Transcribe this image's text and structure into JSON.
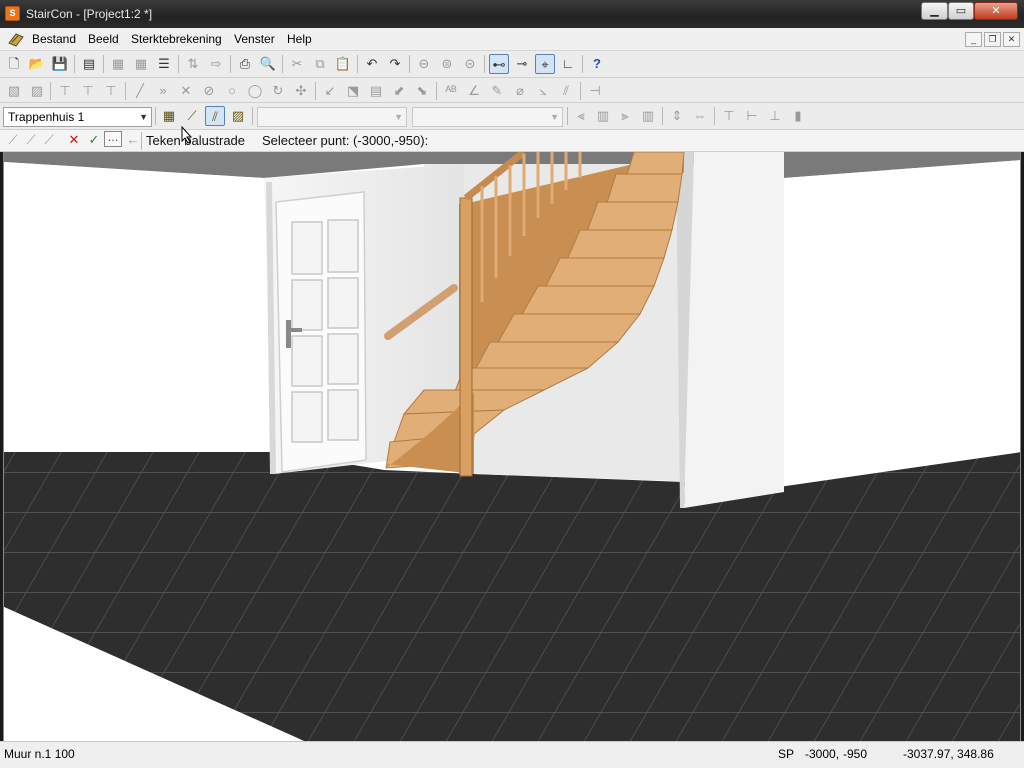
{
  "window": {
    "title": "StairCon - [Project1:2 *]",
    "app_icon_glyph": "S"
  },
  "menu": {
    "items": [
      "Bestand",
      "Beeld",
      "Sterktebrekening",
      "Venster",
      "Help"
    ]
  },
  "toolbar3": {
    "stairwell_select": "Trappenhuis 1",
    "combo2_value": "",
    "combo3_value": ""
  },
  "command_line": {
    "command": "Teken balustrade",
    "prompt": "Selecteer punt: (-3000,-950):"
  },
  "status": {
    "left": "Muur n.1 100",
    "sp_label": "SP",
    "x": "-3000,",
    "y": "-950",
    "coords": "-3037.97, 348.86"
  },
  "colors": {
    "floor": "#2b2b2b",
    "wood": "#d9a46b",
    "walls": "#f2f2f2",
    "accent_pressed": "#d4e4f7"
  },
  "icons": {
    "confirm": "check-icon",
    "cancel": "x-icon",
    "back": "arrow-left-icon"
  }
}
